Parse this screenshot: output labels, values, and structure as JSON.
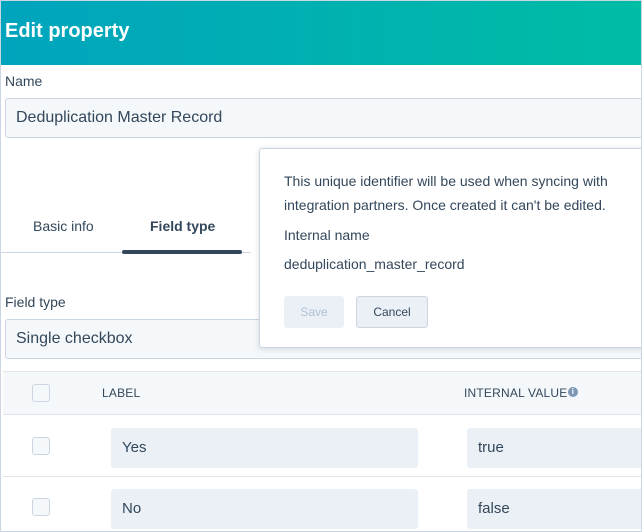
{
  "header": {
    "title": "Edit property"
  },
  "name_field": {
    "label": "Name",
    "value": "Deduplication Master Record"
  },
  "tabs": [
    {
      "label": "Basic info",
      "active": false
    },
    {
      "label": "Field type",
      "active": true
    }
  ],
  "field_type": {
    "label": "Field type",
    "value": "Single checkbox"
  },
  "options_table": {
    "columns": {
      "label": "LABEL",
      "internal_value": "INTERNAL VALUE"
    },
    "info_icon": "info-icon",
    "rows": [
      {
        "label": "Yes",
        "internal_value": "true",
        "checked": false
      },
      {
        "label": "No",
        "internal_value": "false",
        "checked": false
      }
    ]
  },
  "popover": {
    "message_line1": "This unique identifier will be used when syncing with",
    "message_line2": "integration partners. Once created it can't be edited.",
    "internal_name_label": "Internal name",
    "internal_name_value": "deduplication_master_record",
    "save_label": "Save",
    "cancel_label": "Cancel"
  },
  "colors": {
    "header_gradient_start": "#00a4bd",
    "header_gradient_end": "#00bda5",
    "text": "#33475b",
    "input_bg": "#f5f8fa",
    "border": "#cbd6e2"
  }
}
